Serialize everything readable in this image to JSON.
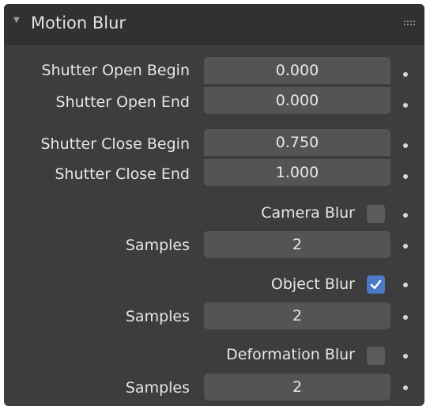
{
  "panel": {
    "title": "Motion Blur",
    "collapse_icon": "triangle-down-icon",
    "grip_icon": "drag-grip-icon"
  },
  "shutter": {
    "open_begin": {
      "label": "Shutter Open Begin",
      "value": "0.000"
    },
    "open_end": {
      "label": "Shutter Open End",
      "value": "0.000"
    },
    "close_begin": {
      "label": "Shutter Close Begin",
      "value": "0.750"
    },
    "close_end": {
      "label": "Shutter Close End",
      "value": "1.000"
    }
  },
  "camera_blur": {
    "label": "Camera Blur",
    "checked": false,
    "samples_label": "Samples",
    "samples": "2"
  },
  "object_blur": {
    "label": "Object Blur",
    "checked": true,
    "samples_label": "Samples",
    "samples": "2"
  },
  "deformation_blur": {
    "label": "Deformation Blur",
    "checked": false,
    "samples_label": "Samples",
    "samples": "2"
  },
  "colors": {
    "panel_bg": "#3d3d3d",
    "header_bg": "#313131",
    "field_bg": "#545454",
    "checkbox_on": "#4b79c4",
    "checkbox_off": "#5b5b5b"
  }
}
